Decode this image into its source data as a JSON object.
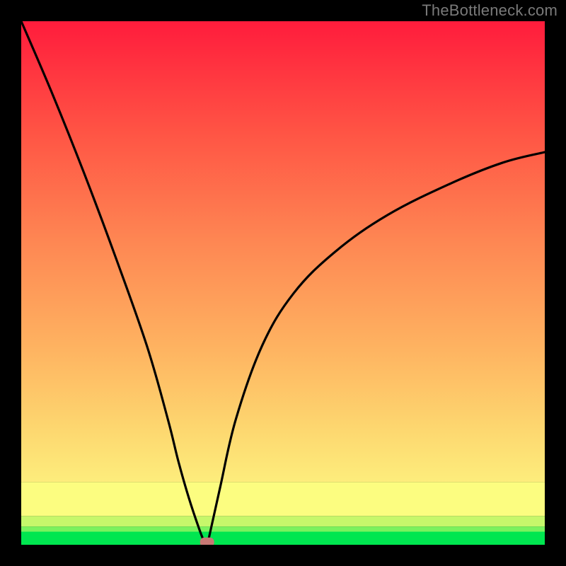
{
  "watermark": "TheBottleneck.com",
  "chart_data": {
    "type": "line",
    "title": "",
    "xlabel": "",
    "ylabel": "",
    "xlim": [
      0,
      100
    ],
    "ylim": [
      0,
      100
    ],
    "grid": false,
    "colormap": "RdYlGn_reversed_vertical",
    "series": [
      {
        "name": "bottleneck-curve",
        "x": [
          0,
          6,
          12,
          18,
          24,
          28,
          30,
          32,
          34,
          35,
          35.5,
          36,
          38,
          41,
          46,
          52,
          60,
          70,
          82,
          92,
          100
        ],
        "y": [
          100,
          86,
          71,
          55,
          38,
          24,
          16,
          9,
          3,
          0.5,
          0,
          2,
          11,
          24,
          38,
          48,
          56,
          63,
          69,
          73,
          75
        ]
      }
    ],
    "marker": {
      "x": 35.5,
      "y": 0.5,
      "color": "#c87874",
      "shape": "rounded-pill"
    },
    "background_bands": [
      {
        "y0": 0,
        "y1": 2.5,
        "color": "#00e650"
      },
      {
        "y0": 2.5,
        "y1": 3.5,
        "color": "#7af25e"
      },
      {
        "y0": 3.5,
        "y1": 5.5,
        "color": "#c6f76b"
      },
      {
        "y0": 5.5,
        "y1": 12,
        "color": "#fcfd80"
      },
      {
        "y0": 12,
        "y1": 100,
        "gradient": [
          "#fded7c",
          "#ff1c3c"
        ]
      }
    ]
  }
}
